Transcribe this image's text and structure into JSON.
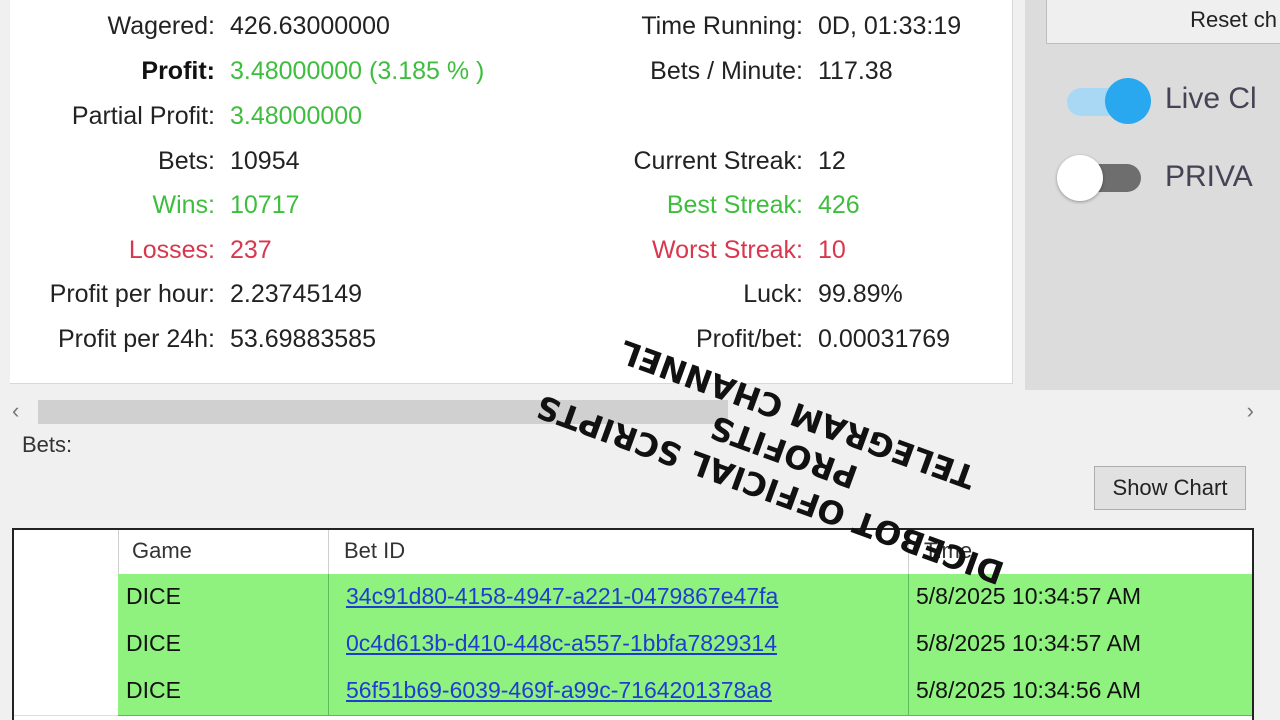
{
  "stats": {
    "wagered": {
      "label": "Wagered:",
      "value": "426.63000000"
    },
    "profit": {
      "label": "Profit:",
      "value": "3.48000000 (3.185 % )"
    },
    "partial_profit": {
      "label": "Partial Profit:",
      "value": "3.48000000"
    },
    "bets": {
      "label": "Bets:",
      "value": "10954"
    },
    "wins": {
      "label": "Wins:",
      "value": "10717"
    },
    "losses": {
      "label": "Losses:",
      "value": "237"
    },
    "profit_per_hour": {
      "label": "Profit per hour:",
      "value": "2.23745149"
    },
    "profit_per_24h": {
      "label": "Profit per 24h:",
      "value": "53.69883585"
    },
    "time_running": {
      "label": "Time Running:",
      "value": "0D, 01:33:19"
    },
    "bets_per_minute": {
      "label": "Bets / Minute:",
      "value": "117.38"
    },
    "current_streak": {
      "label": "Current Streak:",
      "value": "12"
    },
    "best_streak": {
      "label": "Best Streak:",
      "value": "426"
    },
    "worst_streak": {
      "label": "Worst Streak:",
      "value": "10"
    },
    "luck": {
      "label": "Luck:",
      "value": "99.89%"
    },
    "profit_bet": {
      "label": "Profit/bet:",
      "value": "0.00031769"
    }
  },
  "right_panel": {
    "reset_label": "Reset ch",
    "live_label": "Live Cl",
    "live_on": true,
    "privacy_label": "PRIVA",
    "privacy_on": false
  },
  "bets_section": {
    "label": "Bets:",
    "show_chart_label": "Show Chart",
    "columns": [
      "Game",
      "Bet ID",
      "Time"
    ],
    "rows": [
      {
        "game": "DICE",
        "bet_id": "34c91d80-4158-4947-a221-0479867e47fa",
        "time": "5/8/2025 10:34:57 AM"
      },
      {
        "game": "DICE",
        "bet_id": "0c4d613b-d410-448c-a557-1bbfa7829314",
        "time": "5/8/2025 10:34:57 AM"
      },
      {
        "game": "DICE",
        "bet_id": "56f51b69-6039-469f-a99c-7164201378a8",
        "time": "5/8/2025 10:34:56 AM"
      }
    ]
  },
  "watermark": {
    "line1": "DICEBOT OFFICIAL SCRIPTS",
    "line2": "PROFITS",
    "line3": "TELEGRAM CHANNEL"
  },
  "colors": {
    "row_green": "#8ff27f",
    "accent_blue": "#29a8f0",
    "profit_green": "#3ebd3e",
    "loss_red": "#d8374d"
  }
}
